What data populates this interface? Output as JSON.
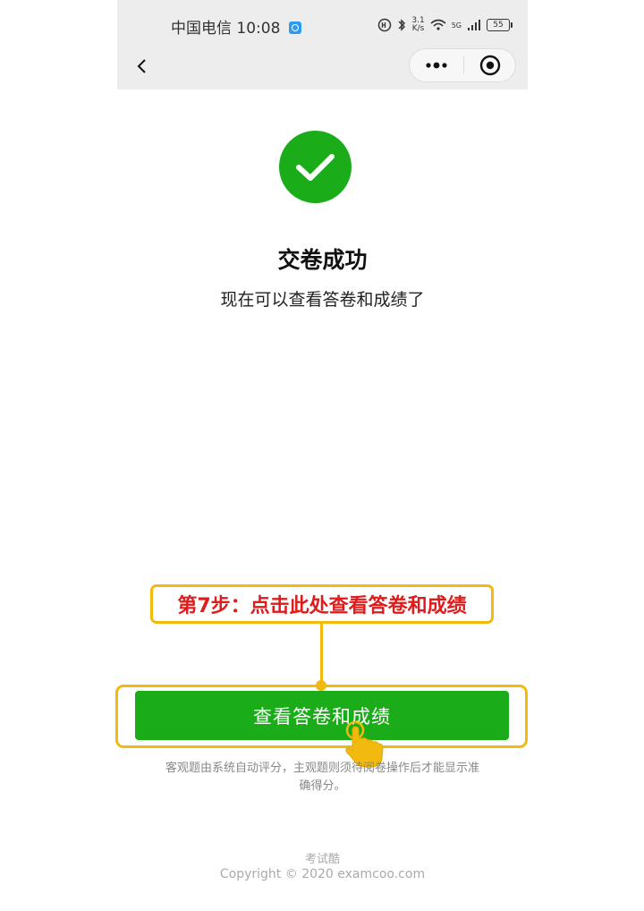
{
  "status_bar": {
    "carrier": "中国电信",
    "time": "10:08",
    "net_speed_value": "3.1",
    "net_speed_unit": "K/s",
    "signal": "5G",
    "battery": "55"
  },
  "nav": {
    "back_icon": "chevron-left-icon",
    "more_icon": "more-dots-icon",
    "close_icon": "target-close-icon"
  },
  "result": {
    "icon": "check-circle-icon",
    "title": "交卷成功",
    "description": "现在可以查看答卷和成绩了"
  },
  "callout": {
    "text": "第7步：点击此处查看答卷和成绩"
  },
  "actions": {
    "view_button_label": "查看答卷和成绩"
  },
  "note": "客观题由系统自动评分，主观题则须待阅卷操作后才能显示准确得分。",
  "footer": {
    "brand": "考试酷",
    "copyright": "Copyright © 2020 examcoo.com"
  },
  "colors": {
    "success_green": "#1aad19",
    "callout_border": "#f2b90f",
    "callout_text": "#e01b1b",
    "nav_bg": "#ededed"
  }
}
